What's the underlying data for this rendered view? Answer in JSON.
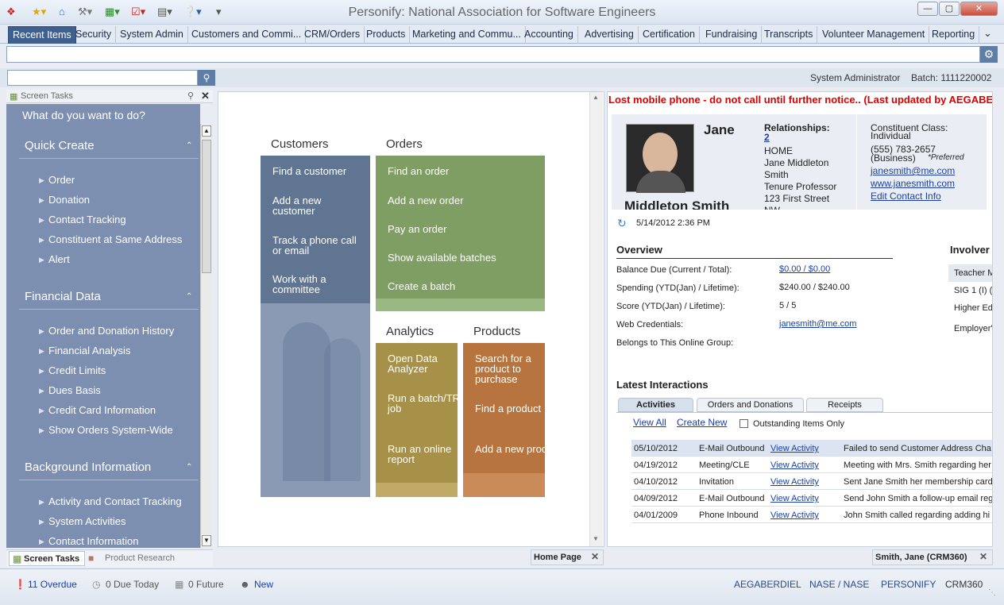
{
  "window": {
    "title": "Personify: National Association for Software Engineers"
  },
  "tabs": [
    "Recent Items",
    "Security",
    "System Admin",
    "Customers and Commi...",
    "CRM/Orders",
    "Products",
    "Marketing and Commu...",
    "Accounting",
    "Advertising",
    "Certification",
    "Fundraising",
    "Transcripts",
    "Volunteer Management",
    "Reporting"
  ],
  "header": {
    "user": "System Administrator",
    "batch": "Batch: 1111220002"
  },
  "left": {
    "panel_title": "Screen Tasks",
    "prompt": "What do you want to do?",
    "sections": [
      {
        "title": "Quick Create",
        "items": [
          "Order",
          "Donation",
          "Contact Tracking",
          "Constituent at Same Address",
          "Alert"
        ]
      },
      {
        "title": "Financial Data",
        "items": [
          "Order and Donation History",
          "Financial Analysis",
          "Credit Limits",
          "Dues Basis",
          "Credit Card Information",
          "Show Orders System-Wide"
        ]
      },
      {
        "title": "Background Information",
        "items": [
          "Activity and Contact Tracking",
          "System Activities",
          "Contact Information"
        ]
      }
    ],
    "footer_tabs": [
      "Screen Tasks",
      "Product Research"
    ]
  },
  "home": {
    "customers": {
      "title": "Customers",
      "links": [
        "Find a customer",
        "Add a new customer",
        "Track a phone call or email",
        "Work with a committee"
      ]
    },
    "orders": {
      "title": "Orders",
      "links": [
        "Find an order",
        "Add a new order",
        "Pay an order",
        "Show available batches",
        "Create a batch"
      ]
    },
    "analytics": {
      "title": "Analytics",
      "links": [
        "Open Data Analyzer",
        "Run a batch/TRS job",
        "Run an online report"
      ]
    },
    "products": {
      "title": "Products",
      "links": [
        "Search for a product to purchase",
        "Find a product",
        "Add a new product"
      ]
    },
    "tab_label": "Home Page"
  },
  "record": {
    "alert": "Lost mobile phone - do not call until further notice.. (Last updated by AEGABERDIEL)",
    "first_name": "Jane",
    "last_name": "Middleton Smith",
    "relationships_label": "Relationships:",
    "relationships_count": "2",
    "address": [
      "HOME",
      "Jane Middleton",
      "Smith",
      "Tenure Professor",
      "123 First Street",
      "NW"
    ],
    "class_label": "Constituent Class:",
    "class_value": "Individual",
    "phone": "(555) 783-2657",
    "phone_type": "(Business)",
    "preferred": "*Preferred",
    "email": "janesmith@me.com",
    "website": "www.janesmith.com",
    "edit_contact": "Edit Contact Info",
    "timestamp": "5/14/2012 2:36 PM",
    "overview_title": "Overview",
    "overview": [
      {
        "label": "Balance Due (Current / Total):",
        "value": "$0.00 / $0.00",
        "link": true
      },
      {
        "label": "Spending (YTD(Jan) / Lifetime):",
        "value": "$240.00 / $240.00",
        "link": false
      },
      {
        "label": "Score (YTD(Jan) / Lifetime):",
        "value": "5 / 5",
        "link": false
      },
      {
        "label": "Web Credentials:",
        "value": "janesmith@me.com",
        "link": true
      },
      {
        "label": "Belongs to This Online Group:",
        "value": "",
        "link": false
      }
    ],
    "involvement_title": "Involver",
    "involvement": [
      "Teacher M",
      "SIG 1 (I) (",
      "Higher Ed",
      "Employer'"
    ],
    "interactions_title": "Latest Interactions",
    "interaction_tabs": [
      "Activities",
      "Orders and Donations",
      "Receipts"
    ],
    "view_all": "View All",
    "create_new": "Create New",
    "outstanding": "Outstanding Items Only",
    "rows": [
      {
        "date": "05/10/2012",
        "type": "E-Mail Outbound",
        "link": "View Activity",
        "desc": "Failed to send Customer Address Cha"
      },
      {
        "date": "04/19/2012",
        "type": "Meeting/CLE",
        "link": "View Activity",
        "desc": "Meeting with Mrs. Smith regarding her"
      },
      {
        "date": "04/10/2012",
        "type": "Invitation",
        "link": "View Activity",
        "desc": "Sent Jane Smith her membership card"
      },
      {
        "date": "04/09/2012",
        "type": "E-Mail Outbound",
        "link": "View Activity",
        "desc": "Send John Smith a follow-up email reg"
      },
      {
        "date": "04/01/2009",
        "type": "Phone Inbound",
        "link": "View Activity",
        "desc": "John Smith called regarding adding hi"
      }
    ],
    "tab_label": "Smith, Jane (CRM360)"
  },
  "status": {
    "overdue": "11 Overdue",
    "today": "0 Due Today",
    "future": "0 Future",
    "new": "New",
    "user": "AEGABERDIEL",
    "org": "NASE / NASE",
    "app": "PERSONIFY",
    "mode": "CRM360"
  },
  "colors": {
    "customers": "#5f7591",
    "orders": "#7f9e63",
    "analytics": "#a79048",
    "products": "#b8743f",
    "alert": "#e00000",
    "leftpanel": "#7d8fb0"
  }
}
